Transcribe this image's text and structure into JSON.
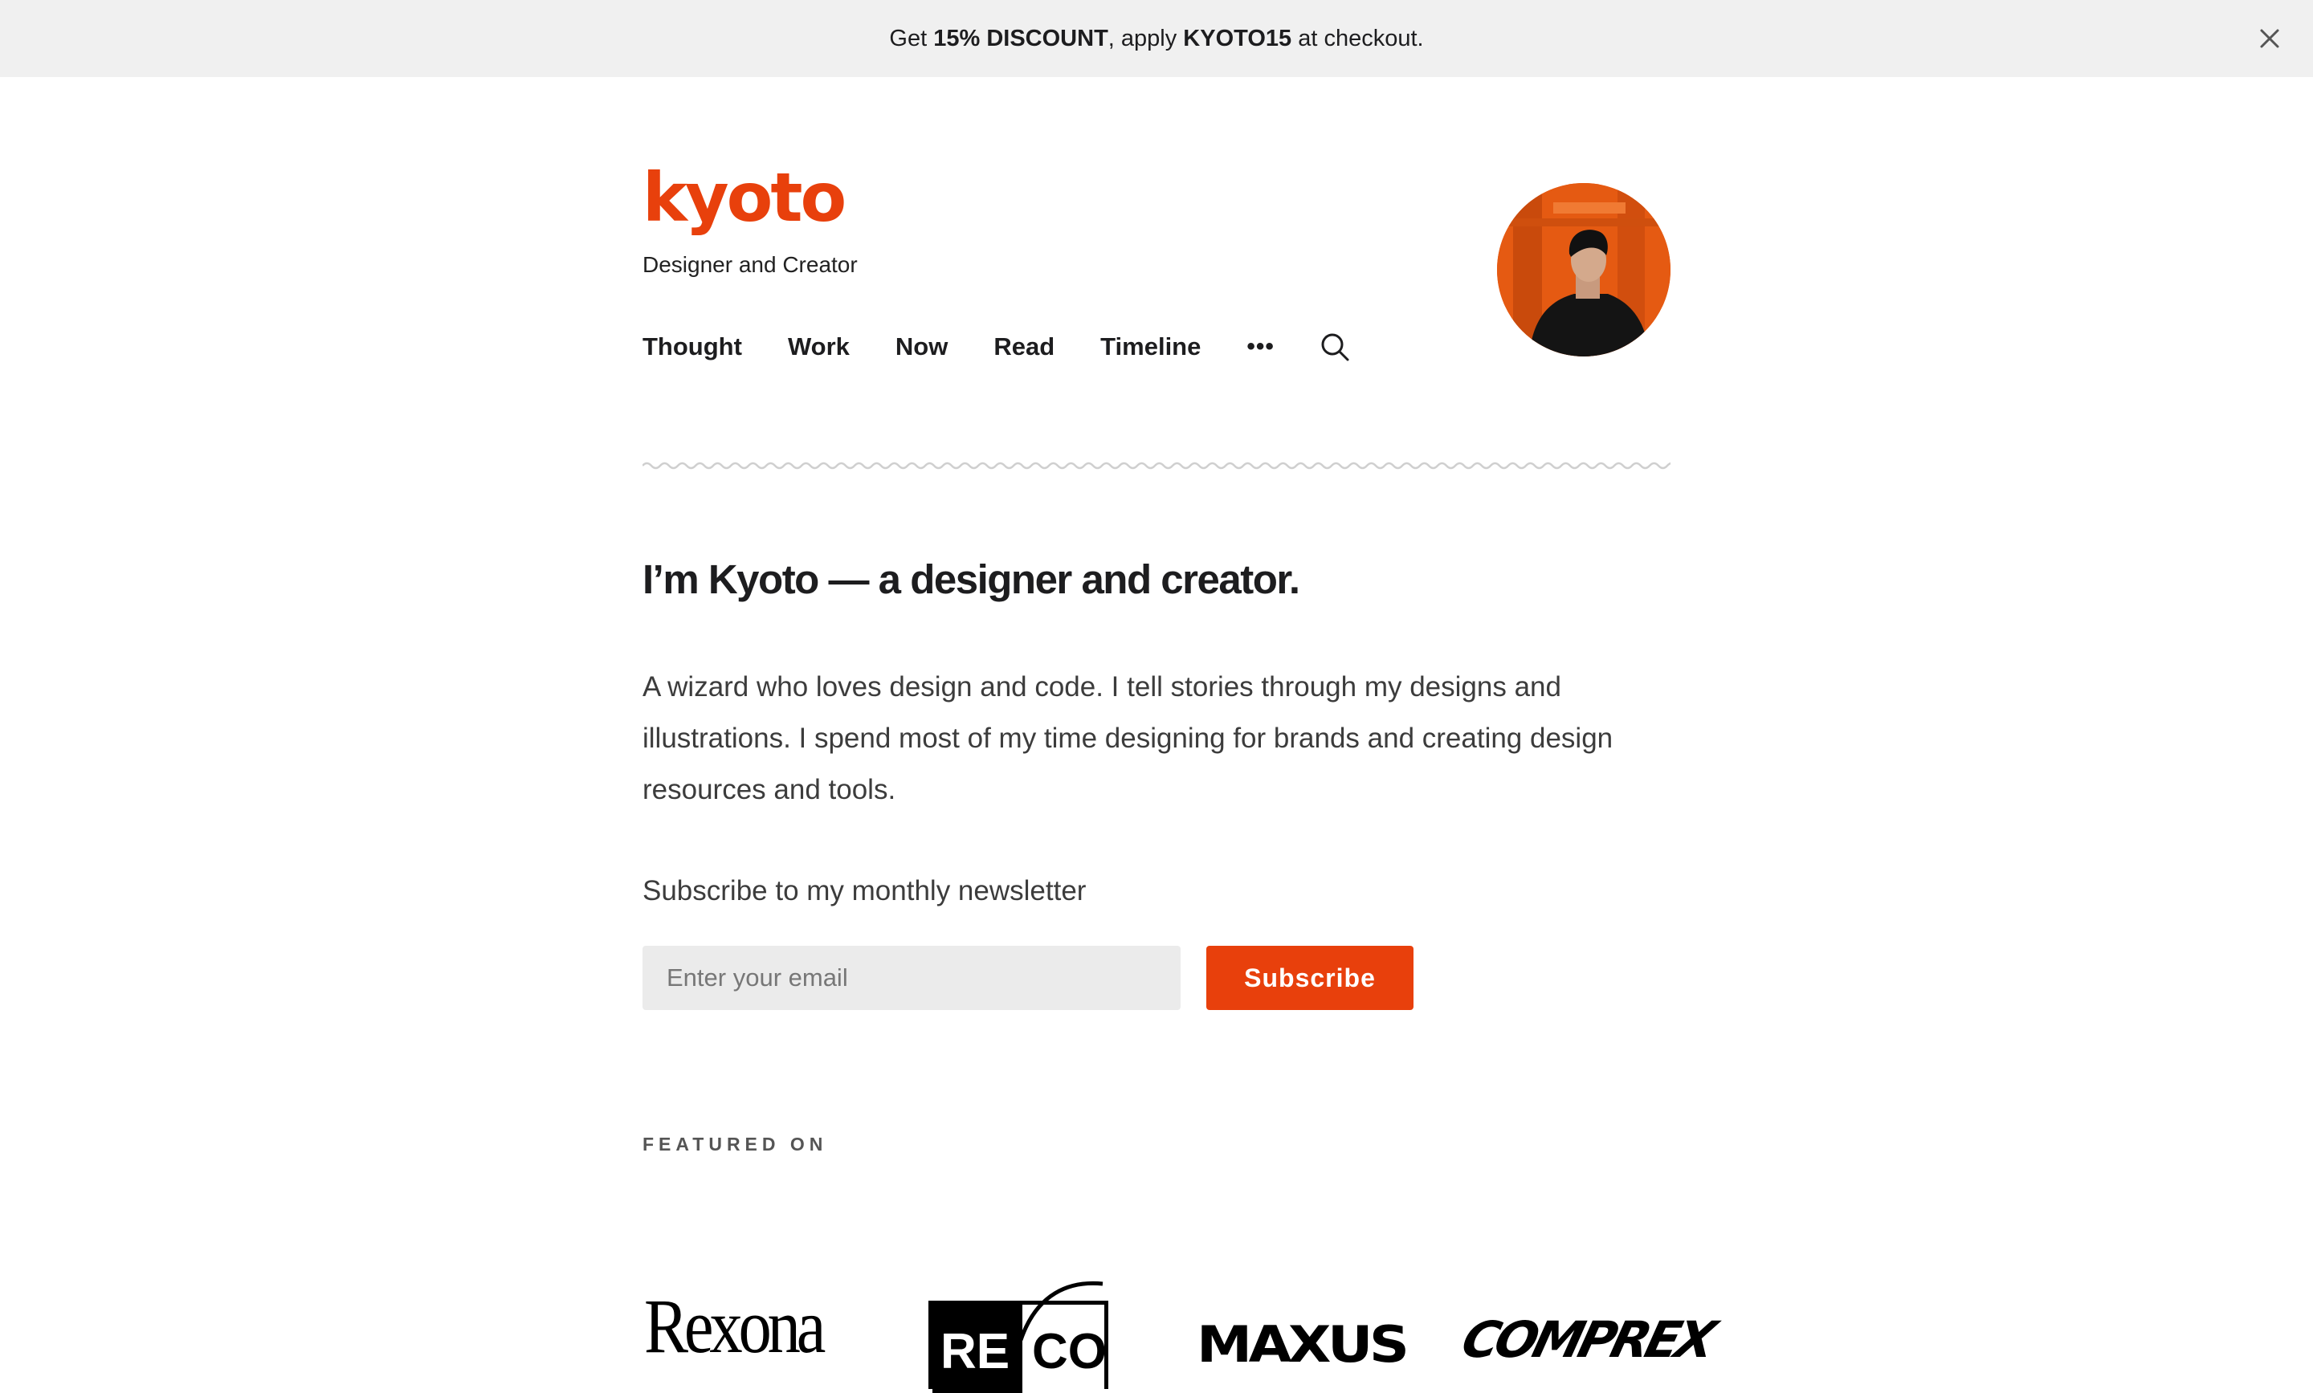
{
  "banner": {
    "pre": "Get ",
    "discount": "15% DISCOUNT",
    "mid": ", apply ",
    "code": "KYOTO15",
    "post": " at checkout.",
    "close_icon": "close-icon"
  },
  "header": {
    "logo": "kyoto",
    "tagline": "Designer and Creator",
    "avatar_alt": "Profile photo",
    "accent_color": "#e8400c"
  },
  "nav": {
    "items": [
      {
        "label": "Thought"
      },
      {
        "label": "Work"
      },
      {
        "label": "Now"
      },
      {
        "label": "Read"
      },
      {
        "label": "Timeline"
      }
    ],
    "more_label": "•••",
    "more_icon": "more-icon",
    "search_icon": "search-icon"
  },
  "main": {
    "headline": "I’m Kyoto — a designer and creator.",
    "intro": "A wizard who loves design and code. I tell stories through my designs and illustrations. I spend most of my time designing for brands and creating design resources and tools."
  },
  "newsletter": {
    "label": "Subscribe to my monthly newsletter",
    "email_placeholder": "Enter your email",
    "email_value": "",
    "button_label": "Subscribe"
  },
  "featured": {
    "label": "FEATURED ON",
    "brands": [
      {
        "name": "Rexona"
      },
      {
        "name_left": "RE",
        "name_right": "CO"
      },
      {
        "name": "MAXUS"
      },
      {
        "name": "COMPREX"
      }
    ]
  }
}
